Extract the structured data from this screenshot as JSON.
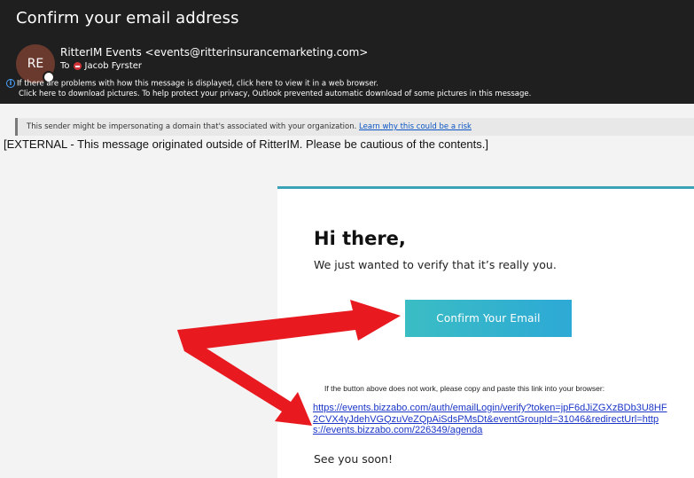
{
  "header": {
    "subject": "Confirm your email address",
    "avatar_initials": "RE",
    "sender": "RitterIM Events <events@ritterinsurancemarketing.com>",
    "to_label": "To",
    "recipient": "Jacob Fyrster",
    "info_line_1": "If there are problems with how this message is displayed, click here to view it in a web browser.",
    "info_line_2": "Click here to download pictures. To help protect your privacy, Outlook prevented automatic download of some pictures in this message."
  },
  "warning": {
    "text": "This sender might be impersonating a domain that's associated with your organization.",
    "link": "Learn why this could be a risk"
  },
  "external_notice": "[EXTERNAL - This message originated outside of RitterIM. Please be cautious of the contents.]",
  "email_body": {
    "greeting": "Hi there,",
    "verify_text": "We just wanted to verify that it’s really you.",
    "button_label": "Confirm Your Email",
    "fallback_note": "If the button above does not work, please copy and paste this link into your browser:",
    "verify_url": "https://events.bizzabo.com/auth/emailLogin/verify?token=jpF6dJiZGXzBDb3U8HF2CVX4yJdehVGQzuVeZQpAiSdsPMsDt&eventGroupId=31046&redirectUrl=https://events.bizzabo.com/226349/agenda",
    "signoff": "See you soon!"
  },
  "colors": {
    "header_bg": "#1f1f1f",
    "button_start": "#3bbdc4",
    "button_end": "#2da9d6",
    "arrow": "#e8191f",
    "link": "#1a35c8"
  }
}
